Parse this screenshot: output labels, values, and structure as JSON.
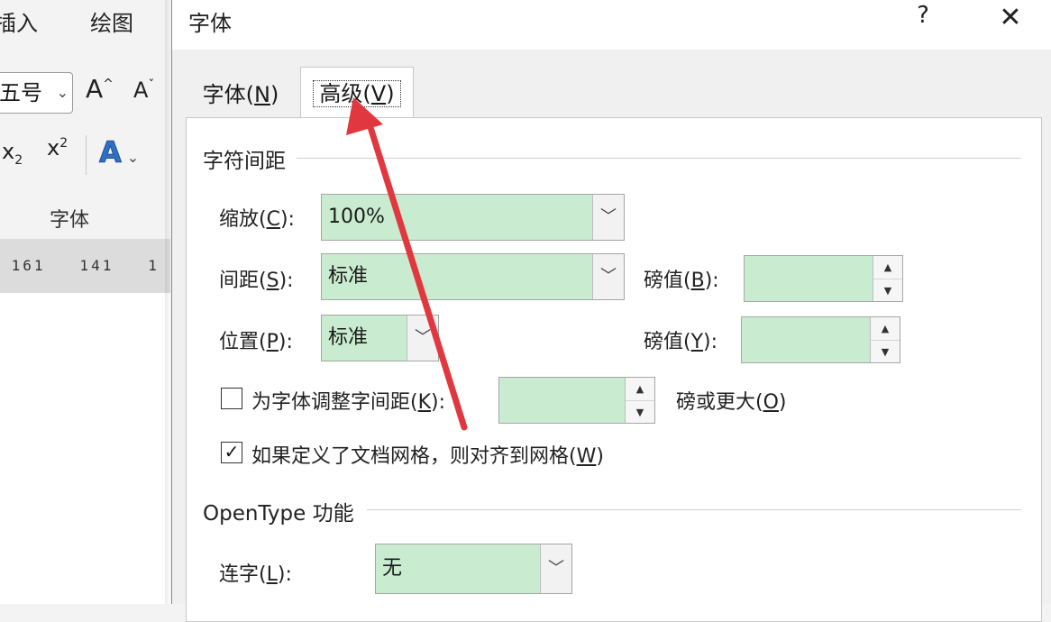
{
  "ribbon": {
    "tab_insert": "插入",
    "tab_draw": "绘图",
    "font_size": "五号",
    "grow_font": "A",
    "shrink_font": "A",
    "subscript": "x",
    "subscript_mark": "2",
    "superscript": "x",
    "superscript_mark": "2",
    "text_effects": "A",
    "group_label": "字体",
    "ruler_text": " 161   141   1"
  },
  "dialog": {
    "title": "字体",
    "help": "?",
    "close": "✕",
    "tabs": [
      {
        "label": "字体(",
        "key": "N",
        "end": ")"
      },
      {
        "label": "高级(",
        "key": "V",
        "end": ")",
        "active": true
      }
    ],
    "character_spacing": {
      "heading": "字符间距",
      "scale": {
        "label": "缩放(",
        "key": "C",
        "end": "):",
        "value": "100%"
      },
      "spacing": {
        "label": "间距(",
        "key": "S",
        "end": "):",
        "value": "标准"
      },
      "spacing_by": {
        "label": "磅值(",
        "key": "B",
        "end": "):",
        "value": ""
      },
      "position": {
        "label": "位置(",
        "key": "P",
        "end": "):",
        "value": "标准"
      },
      "position_by": {
        "label": "磅值(",
        "key": "Y",
        "end": "):",
        "value": ""
      },
      "kerning": {
        "label": "为字体调整字间距(",
        "key": "K",
        "end": "):",
        "checked": false,
        "value": ""
      },
      "kerning_suffix": {
        "label": "磅或更大(",
        "key": "O",
        "end": ")"
      },
      "snap_to_grid": {
        "label": "如果定义了文档网格，则对齐到网格(",
        "key": "W",
        "end": ")",
        "checked": true
      }
    },
    "opentype": {
      "heading": "OpenType 功能",
      "ligatures": {
        "label": "连字(",
        "key": "L",
        "end": "):",
        "value": "无"
      }
    }
  },
  "colors": {
    "field_fill": "#c9ecd0",
    "annotation_arrow": "#e0383e"
  }
}
